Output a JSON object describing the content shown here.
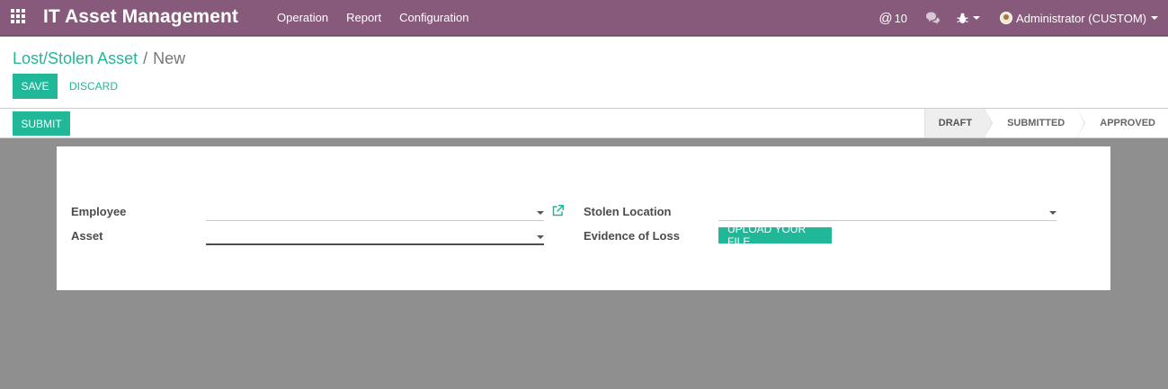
{
  "navbar": {
    "app_title": "IT Asset Management",
    "menu": [
      "Operation",
      "Report",
      "Configuration"
    ],
    "mentions_count": "10",
    "user_label": "Administrator (CUSTOM)"
  },
  "breadcrumb": {
    "parent": "Lost/Stolen Asset",
    "separator": "/",
    "current": "New"
  },
  "actions": {
    "save": "SAVE",
    "discard": "DISCARD"
  },
  "statusbar": {
    "submit": "SUBMIT",
    "stages": [
      "DRAFT",
      "SUBMITTED",
      "APPROVED"
    ],
    "active_stage": "DRAFT"
  },
  "form": {
    "employee": {
      "label": "Employee",
      "value": ""
    },
    "asset": {
      "label": "Asset",
      "value": ""
    },
    "stolen_location": {
      "label": "Stolen Location",
      "value": ""
    },
    "evidence": {
      "label": "Evidence of Loss",
      "button": "UPLOAD YOUR FILE"
    }
  },
  "colors": {
    "navbar": "#875a7b",
    "accent": "#21b799",
    "backdrop": "#8f8f8f"
  },
  "icons": {
    "apps": "apps-grid-icon",
    "mentions": "at-icon",
    "chat": "chat-icon",
    "debug": "bug-icon",
    "external": "external-link-icon"
  }
}
